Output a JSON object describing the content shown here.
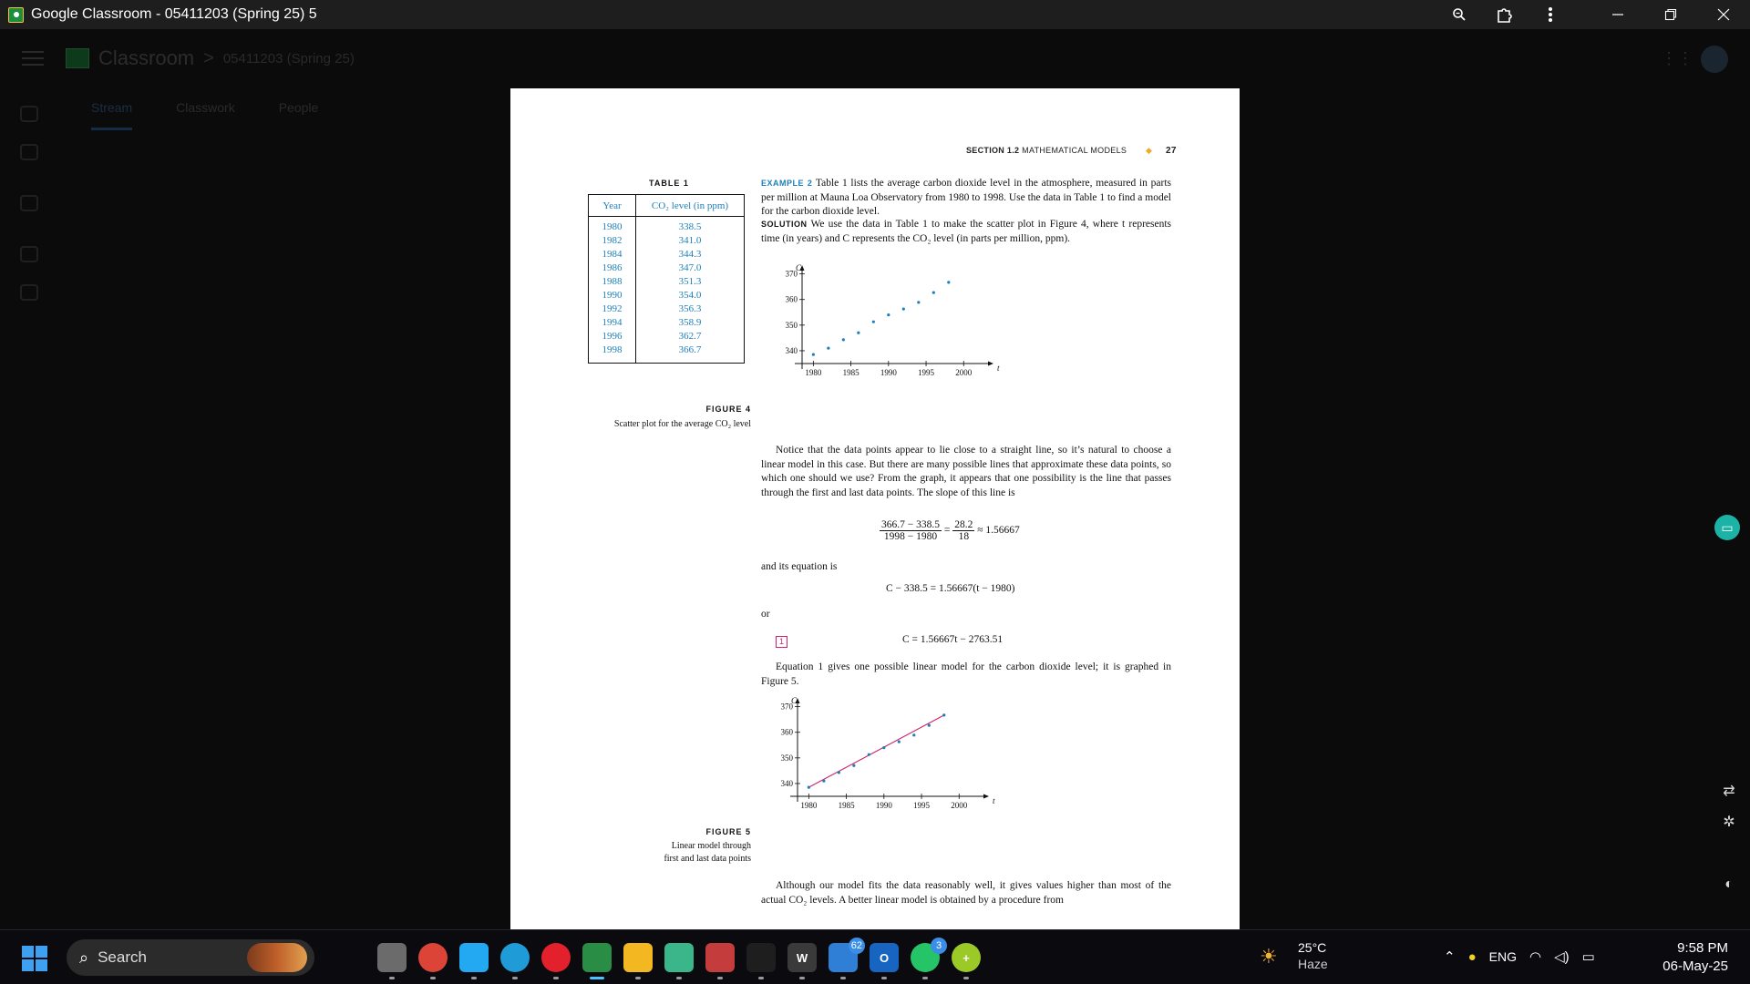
{
  "window": {
    "title": "Google Classroom - 05411203 (Spring 25) 5",
    "icons": [
      "zoom-icon",
      "extensions-icon",
      "more-icon",
      "minimize-icon",
      "restore-icon",
      "close-icon"
    ]
  },
  "classroom": {
    "brand": "Classroom",
    "separator": ">",
    "course": "05411203 (Spring 25)",
    "tabs": [
      "Stream",
      "Classwork",
      "People"
    ]
  },
  "document": {
    "running_head": {
      "section": "SECTION 1.2",
      "title": "MATHEMATICAL MODELS",
      "page": "27"
    },
    "table": {
      "title": "TABLE 1",
      "headers": [
        "Year",
        "CO₂ level (in ppm)"
      ],
      "rows": [
        [
          "1980",
          "338.5"
        ],
        [
          "1982",
          "341.0"
        ],
        [
          "1984",
          "344.3"
        ],
        [
          "1986",
          "347.0"
        ],
        [
          "1988",
          "351.3"
        ],
        [
          "1990",
          "354.0"
        ],
        [
          "1992",
          "356.3"
        ],
        [
          "1994",
          "358.9"
        ],
        [
          "1996",
          "362.7"
        ],
        [
          "1998",
          "366.7"
        ]
      ]
    },
    "example_label": "EXAMPLE 2",
    "example_text": "Table 1 lists the average carbon dioxide level in the atmosphere, measured in parts per million at Mauna Loa Observatory from 1980 to 1998. Use the data in Table 1 to find a model for the carbon dioxide level.",
    "solution_label": "SOLUTION",
    "solution_text": "We use the data in Table 1 to make the scatter plot in Figure 4, where t represents time (in years) and C represents the CO₂ level (in parts per million, ppm).",
    "figure4": {
      "label": "FIGURE 4",
      "caption": "Scatter plot for the average CO₂ level"
    },
    "notice_text": "Notice that the data points appear to lie close to a straight line, so it’s natural to choose a linear model in this case. But there are many possible lines that approximate these data points, so which one should we use? From the graph, it appears that one possibility is the line that passes through the first and last data points. The slope of this line is",
    "slope_eq": {
      "num1": "366.7 − 338.5",
      "den1": "1998 − 1980",
      "eq": "=",
      "num2": "28.2",
      "den2": "18",
      "approx": "≈ 1.56667"
    },
    "and_eq_text": "and its equation is",
    "point_slope_eq": "C − 338.5 = 1.56667(t − 1980)",
    "or_text": "or",
    "eq_number": "1",
    "final_eq": "C = 1.56667t − 2763.51",
    "equation1_text": "Equation 1 gives one possible linear model for the carbon dioxide level; it is graphed in Figure 5.",
    "figure5": {
      "label": "FIGURE 5",
      "caption_line1": "Linear model through",
      "caption_line2": "first and last data points"
    },
    "bottom_text": "Although our model fits the data reasonably well, it gives values higher than most of the actual CO₂ levels. A better linear model is obtained by a procedure from"
  },
  "chart_data": [
    {
      "type": "scatter",
      "title": "",
      "xlabel": "t",
      "ylabel": "C",
      "x_ticks": [
        1980,
        1985,
        1990,
        1995,
        2000
      ],
      "y_ticks": [
        340,
        350,
        360,
        370
      ],
      "xlim": [
        1978.5,
        2003
      ],
      "ylim": [
        335,
        372
      ],
      "point_color": "#1d7fb8",
      "points": [
        [
          1980,
          338.5
        ],
        [
          1982,
          341.0
        ],
        [
          1984,
          344.3
        ],
        [
          1986,
          347.0
        ],
        [
          1988,
          351.3
        ],
        [
          1990,
          354.0
        ],
        [
          1992,
          356.3
        ],
        [
          1994,
          358.9
        ],
        [
          1996,
          362.7
        ],
        [
          1998,
          366.7
        ]
      ]
    },
    {
      "type": "scatter",
      "title": "",
      "xlabel": "t",
      "ylabel": "C",
      "x_ticks": [
        1980,
        1985,
        1990,
        1995,
        2000
      ],
      "y_ticks": [
        340,
        350,
        360,
        370
      ],
      "xlim": [
        1978.5,
        2003
      ],
      "ylim": [
        335,
        372
      ],
      "point_color": "#1d7fb8",
      "line_color": "#d0216b",
      "line": [
        [
          1980,
          338.5
        ],
        [
          1998,
          366.7
        ]
      ],
      "points": [
        [
          1980,
          338.5
        ],
        [
          1982,
          341.0
        ],
        [
          1984,
          344.3
        ],
        [
          1986,
          347.0
        ],
        [
          1988,
          351.3
        ],
        [
          1990,
          354.0
        ],
        [
          1992,
          356.3
        ],
        [
          1994,
          358.9
        ],
        [
          1996,
          362.7
        ],
        [
          1998,
          366.7
        ]
      ]
    }
  ],
  "taskbar": {
    "search_placeholder": "Search",
    "apps": [
      {
        "name": "task-view",
        "label": ""
      },
      {
        "name": "chrome",
        "label": ""
      },
      {
        "name": "vscode",
        "label": ""
      },
      {
        "name": "edge",
        "label": ""
      },
      {
        "name": "opera",
        "label": ""
      },
      {
        "name": "google-classroom",
        "label": ""
      },
      {
        "name": "file-explorer",
        "label": ""
      },
      {
        "name": "app-green",
        "label": ""
      },
      {
        "name": "app-colorful",
        "label": ""
      },
      {
        "name": "app-terminal",
        "label": ""
      },
      {
        "name": "word",
        "label": "W"
      },
      {
        "name": "app-blue",
        "label": "",
        "badge": "62"
      },
      {
        "name": "outlook",
        "label": "O"
      },
      {
        "name": "whatsapp",
        "label": "",
        "badge": "3"
      },
      {
        "name": "app-plus",
        "label": "+"
      }
    ],
    "weather": {
      "temp": "25°C",
      "condition": "Haze"
    },
    "language": "ENG",
    "time": "9:58 PM",
    "date": "06-May-25"
  }
}
